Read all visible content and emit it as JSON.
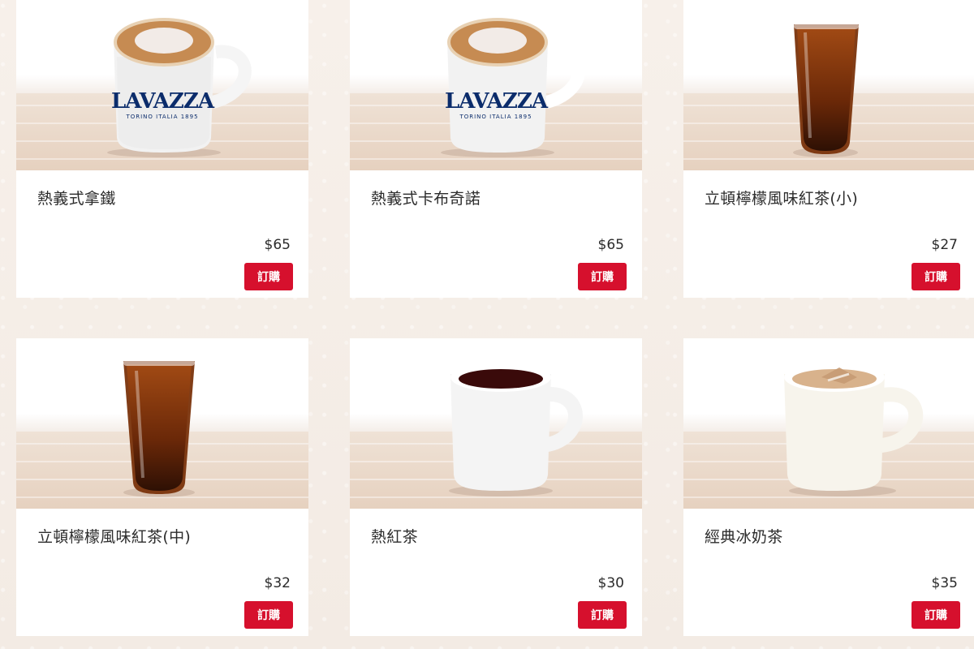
{
  "products": [
    {
      "name": "熱義式拿鐵",
      "price": "$65",
      "order_label": "訂購",
      "icon": "lavazza-latte-cup",
      "brand_text": "LAVAZZA",
      "brand_subtext": "TORINO ITALIA 1895"
    },
    {
      "name": "熱義式卡布奇諾",
      "price": "$65",
      "order_label": "訂購",
      "icon": "lavazza-cappuccino-cup",
      "brand_text": "LAVAZZA",
      "brand_subtext": "TORINO ITALIA 1895"
    },
    {
      "name": "立頓檸檬風味紅茶(小)",
      "price": "$27",
      "order_label": "訂購",
      "icon": "iced-tea-glass-small"
    },
    {
      "name": "立頓檸檬風味紅茶(中)",
      "price": "$32",
      "order_label": "訂購",
      "icon": "iced-tea-glass-medium"
    },
    {
      "name": "熱紅茶",
      "price": "$30",
      "order_label": "訂購",
      "icon": "hot-tea-mug"
    },
    {
      "name": "經典冰奶茶",
      "price": "$35",
      "order_label": "訂購",
      "icon": "milk-tea-mug"
    }
  ],
  "colors": {
    "order_button": "#d6102d",
    "brand_blue": "#0b2c6b"
  }
}
